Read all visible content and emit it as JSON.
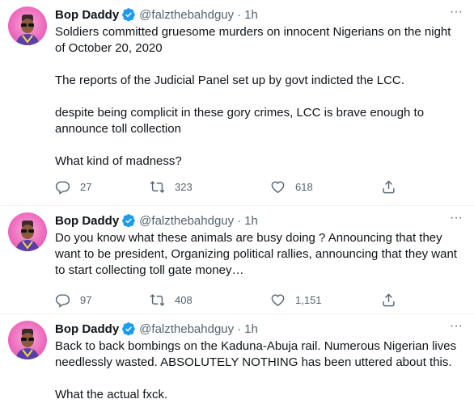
{
  "tweets": [
    {
      "author": {
        "name": "Bop Daddy",
        "handle": "@falzthebahdguy",
        "time": "1h"
      },
      "paragraphs": [
        "Soldiers committed gruesome murders on innocent Nigerians on the night of October 20, 2020",
        "The reports of the Judicial Panel set up by govt indicted the LCC.",
        "despite being complicit in these gory crimes, LCC is brave enough to announce toll collection",
        "What kind of madness?"
      ],
      "stats": {
        "replies": "27",
        "retweets": "323",
        "likes": "618"
      }
    },
    {
      "author": {
        "name": "Bop Daddy",
        "handle": "@falzthebahdguy",
        "time": "1h"
      },
      "paragraphs": [
        "Do you know what these animals are busy doing ? Announcing that they want to be president, Organizing political rallies, announcing that they want to start collecting toll gate money…"
      ],
      "stats": {
        "replies": "97",
        "retweets": "408",
        "likes": "1,151"
      }
    },
    {
      "author": {
        "name": "Bop Daddy",
        "handle": "@falzthebahdguy",
        "time": "1h"
      },
      "paragraphs": [
        "Back to back bombings on the Kaduna-Abuja rail. Numerous Nigerian lives needlessly wasted. ABSOLUTELY NOTHING has been uttered about this.",
        "What the actual fxck."
      ]
    }
  ],
  "icons": {
    "more": "more-options-icon",
    "verified": "verified-badge-icon",
    "reply": "reply-icon",
    "retweet": "retweet-icon",
    "like": "like-icon",
    "share": "share-icon"
  },
  "colors": {
    "text": "#0f1419",
    "secondary": "#536471",
    "verified": "#1d9bf0",
    "divider": "#eff3f4",
    "avatar_bg": "#ee6fbf"
  },
  "separator": "·",
  "more_glyph": "···"
}
